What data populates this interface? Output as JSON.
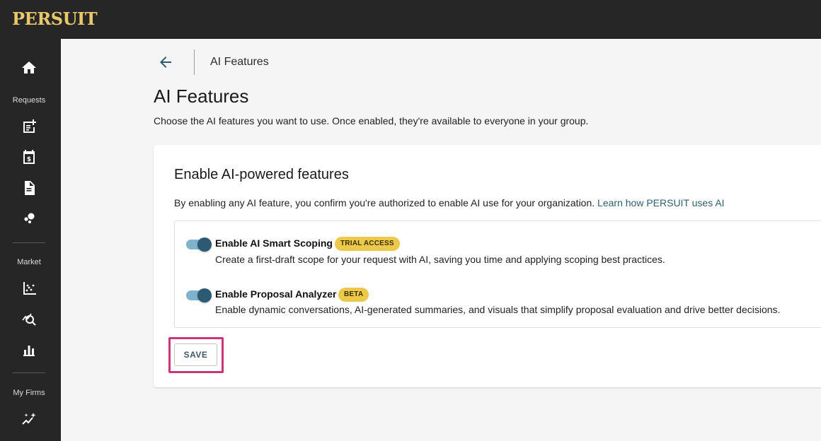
{
  "brand": {
    "logo_text": "PERSUIT",
    "logo_color": "#e8c86a"
  },
  "sidebar": {
    "sections": {
      "requests": "Requests",
      "market": "Market",
      "my_firms": "My Firms"
    },
    "icons": [
      "home-icon",
      "add-request-icon",
      "calendar-dollar-icon",
      "document-icon",
      "bubbles-icon",
      "scatter-chart-icon",
      "search-chart-icon",
      "bar-chart-icon",
      "sparkle-trend-icon"
    ]
  },
  "header": {
    "back_icon": "arrow-left-icon",
    "breadcrumb": "AI Features"
  },
  "page": {
    "title": "AI Features",
    "description": "Choose the AI features you want to use. Once enabled, they're available to everyone in your group."
  },
  "card": {
    "title": "Enable AI-powered features",
    "description": "By enabling any AI feature, you confirm you're authorized to enable AI use for your organization.",
    "link_text": "Learn how PERSUIT uses AI",
    "features": [
      {
        "name": "Enable AI Smart Scoping",
        "badge": "TRIAL ACCESS",
        "enabled": true,
        "description": "Create a first-draft scope for your request with AI, saving you time and applying scoping best practices."
      },
      {
        "name": "Enable Proposal Analyzer",
        "badge": "BETA",
        "enabled": true,
        "description": "Enable dynamic conversations, AI-generated summaries, and visuals that simplify proposal evaluation and drive better decisions."
      }
    ],
    "save_label": "SAVE"
  },
  "colors": {
    "accent": "#2c5a72",
    "toggle_track": "#7fb3cd",
    "badge": "#ecc94b",
    "highlight": "#c9367a",
    "link": "#2e5f73"
  }
}
